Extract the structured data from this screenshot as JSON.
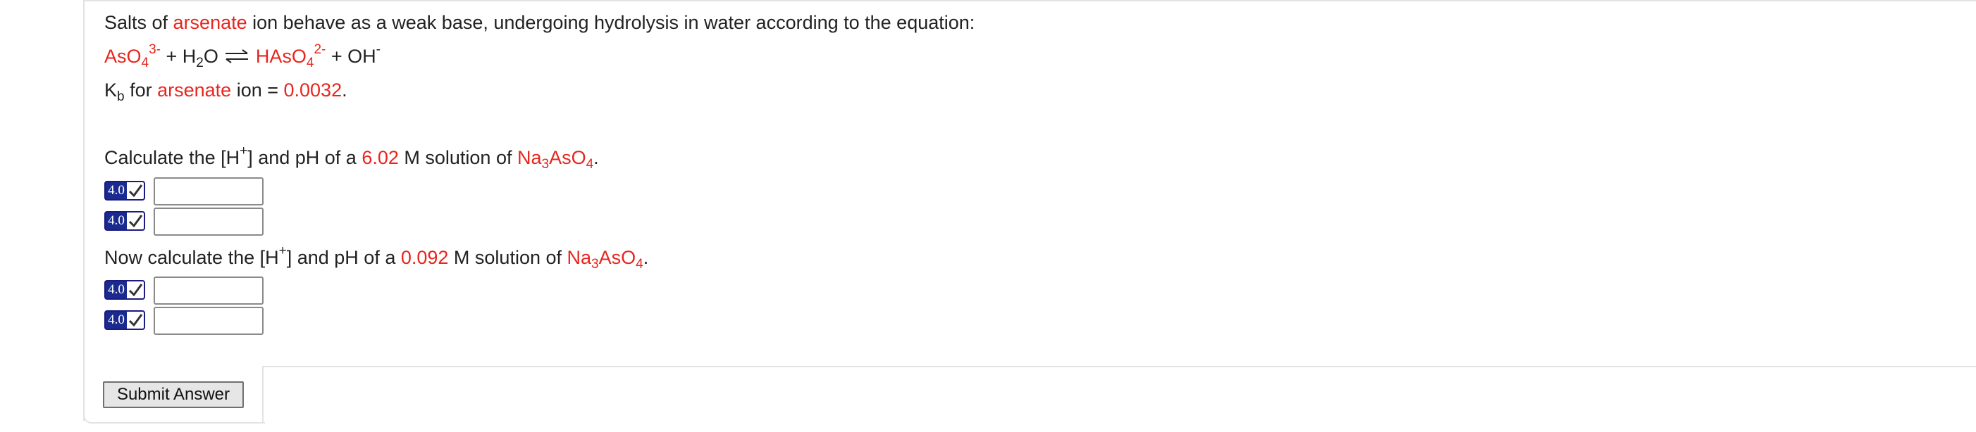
{
  "intro": {
    "t1": "Salts of ",
    "t2": "arsenate",
    "t3": " ion behave as a weak base, undergoing hydrolysis in water according to the equation:"
  },
  "equation": {
    "reactant1": "AsO",
    "reactant1_sub": "4",
    "reactant1_sup": "3-",
    "plus1": " + H",
    "water_sub": "2",
    "water_o": "O ",
    "product1": "HAsO",
    "product1_sub": "4",
    "product1_sup": "2-",
    "plus2": " + OH",
    "oh_sup": "-"
  },
  "kb": {
    "k": "K",
    "k_sub": "b",
    "t1": " for ",
    "t2": "arsenate",
    "t3": " ion = ",
    "value": "0.0032",
    "end": "."
  },
  "q1": {
    "t1": "Calculate the [H",
    "sup": "+",
    "t2": "] and pH of a ",
    "conc": "6.02",
    "t3": " M solution of ",
    "f1": "Na",
    "f1_sub": "3",
    "f2": "AsO",
    "f2_sub": "4",
    "end": "."
  },
  "q2": {
    "t1": "Now calculate the [H",
    "sup": "+",
    "t2": "] and pH of a ",
    "conc": "0.092",
    "t3": " M solution of ",
    "f1": "Na",
    "f1_sub": "3",
    "f2": "AsO",
    "f2_sub": "4",
    "end": "."
  },
  "answers": {
    "points": "4.0",
    "values": [
      "",
      "",
      "",
      ""
    ]
  },
  "submit": {
    "label": "Submit Answer"
  },
  "colors": {
    "highlight": "#e8251d",
    "badge": "#1a2a8f",
    "check": "#2a7a2a"
  },
  "icons": {
    "badge_check": "checkmark-icon",
    "equilibrium": "equilibrium-arrow-icon"
  }
}
